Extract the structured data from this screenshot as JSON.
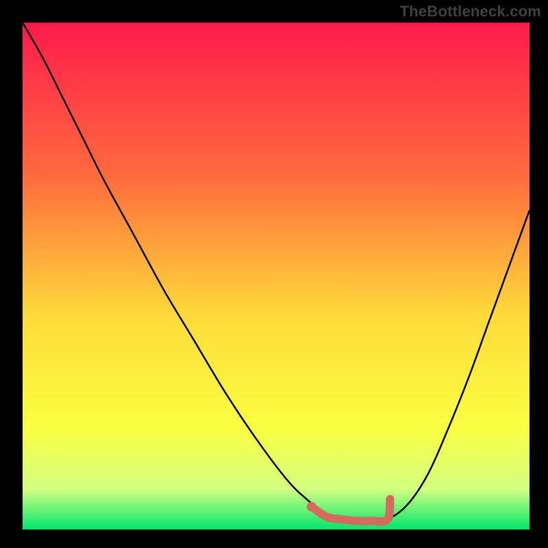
{
  "attribution": "TheBottleneck.com",
  "colors": {
    "frame": "#000000",
    "curve": "#000000",
    "marker": "#d66a5e",
    "grad_top": "#ff1a4c",
    "grad_mid1": "#ff6a3d",
    "grad_mid2": "#ffdb3a",
    "grad_low1": "#faff40",
    "grad_low2": "#d4ff80",
    "grad_bottom": "#00e66b"
  },
  "chart_data": {
    "type": "line",
    "title": "",
    "xlabel": "",
    "ylabel": "",
    "xlim": [
      0,
      1
    ],
    "ylim": [
      0,
      1
    ],
    "series": [
      {
        "name": "bottleneck-curve",
        "x": [
          0.0,
          0.04,
          0.08,
          0.12,
          0.16,
          0.22,
          0.28,
          0.34,
          0.4,
          0.46,
          0.52,
          0.56,
          0.6,
          0.63,
          0.66,
          0.69,
          0.72,
          0.76,
          0.8,
          0.84,
          0.88,
          0.92,
          0.96,
          1.0
        ],
        "y": [
          1.0,
          0.93,
          0.85,
          0.77,
          0.69,
          0.58,
          0.47,
          0.37,
          0.27,
          0.18,
          0.1,
          0.06,
          0.03,
          0.02,
          0.015,
          0.015,
          0.02,
          0.05,
          0.11,
          0.2,
          0.3,
          0.41,
          0.52,
          0.63
        ]
      },
      {
        "name": "optimal-range-marker",
        "x": [
          0.57,
          0.6,
          0.63,
          0.66,
          0.69,
          0.72,
          0.725
        ],
        "y": [
          0.045,
          0.025,
          0.02,
          0.017,
          0.017,
          0.02,
          0.06
        ]
      }
    ],
    "gradient_stops": [
      {
        "offset": 0.0,
        "color": "#ff1a4c"
      },
      {
        "offset": 0.3,
        "color": "#ff6a3d"
      },
      {
        "offset": 0.58,
        "color": "#ffdb3a"
      },
      {
        "offset": 0.8,
        "color": "#faff40"
      },
      {
        "offset": 0.92,
        "color": "#d4ff80"
      },
      {
        "offset": 1.0,
        "color": "#00e66b"
      }
    ]
  }
}
